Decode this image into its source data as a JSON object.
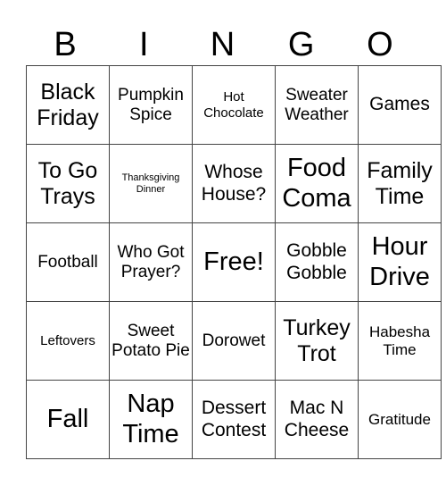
{
  "header": [
    "B",
    "I",
    "N",
    "G",
    "O"
  ],
  "rows": [
    [
      {
        "text": "Black Friday",
        "size": "s24"
      },
      {
        "text": "Pumpkin Spice",
        "size": "s19"
      },
      {
        "text": "Hot Chocolate",
        "size": "s15"
      },
      {
        "text": "Sweater Weather",
        "size": "s19"
      },
      {
        "text": "Games",
        "size": "s21"
      }
    ],
    [
      {
        "text": "To Go Trays",
        "size": "s24"
      },
      {
        "text": "Thanksgiving Dinner",
        "size": "s11"
      },
      {
        "text": "Whose House?",
        "size": "s21"
      },
      {
        "text": "Food Coma",
        "size": "s29"
      },
      {
        "text": "Family Time",
        "size": "s24"
      }
    ],
    [
      {
        "text": "Football",
        "size": "s19"
      },
      {
        "text": "Who Got Prayer?",
        "size": "s19"
      },
      {
        "text": "Free!",
        "size": "s29"
      },
      {
        "text": "Gobble Gobble",
        "size": "s21"
      },
      {
        "text": "Hour Drive",
        "size": "s29"
      }
    ],
    [
      {
        "text": "Leftovers",
        "size": "s15"
      },
      {
        "text": "Sweet Potato Pie",
        "size": "s19"
      },
      {
        "text": "Dorowet",
        "size": "s19"
      },
      {
        "text": "Turkey Trot",
        "size": "s24"
      },
      {
        "text": "Habesha Time",
        "size": "s17"
      }
    ],
    [
      {
        "text": "Fall",
        "size": "s29"
      },
      {
        "text": "Nap Time",
        "size": "s29"
      },
      {
        "text": "Dessert Contest",
        "size": "s21"
      },
      {
        "text": "Mac N Cheese",
        "size": "s21"
      },
      {
        "text": "Gratitude",
        "size": "s17"
      }
    ]
  ]
}
